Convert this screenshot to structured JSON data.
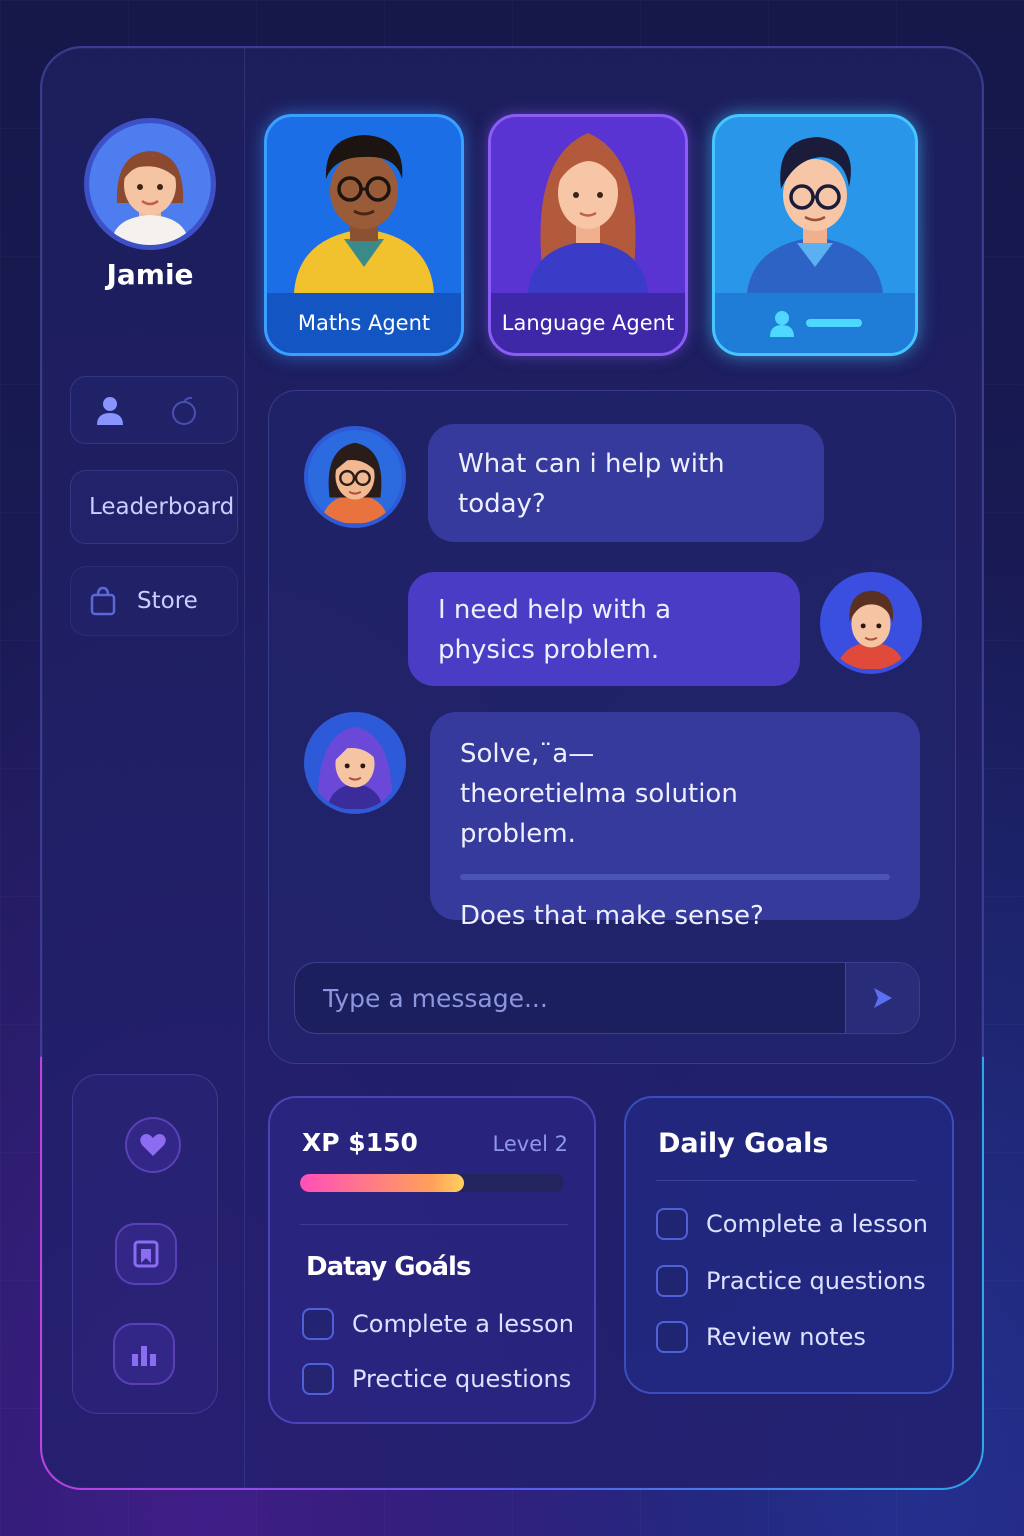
{
  "user": {
    "name": "Jamie"
  },
  "agents": [
    {
      "label": "Maths Agent"
    },
    {
      "label": "Language Agent"
    },
    {
      "label": ""
    }
  ],
  "sidebar": {
    "leaderboard_label": "Leaderboard",
    "store_label": "Store"
  },
  "chat": {
    "messages": [
      {
        "from": "agent",
        "text": "What can i help with today?"
      },
      {
        "from": "user",
        "text": "I need help with a physics problem."
      },
      {
        "from": "agent",
        "text": "Solve,¨a—theoretielma solution problem.",
        "followup": "Does that make sense?"
      }
    ],
    "input": {
      "placeholder": "Type a message...",
      "value": ""
    }
  },
  "progress": {
    "xp_label": "XP $150",
    "level_label": "Level 2",
    "xp_fill_fraction": 0.62,
    "goals_title": "Datay Goáls",
    "goals": [
      {
        "label": "Complete a lesson",
        "checked": false
      },
      {
        "label": "Precticе questions",
        "checked": false
      }
    ]
  },
  "daily_goals": {
    "title": "Daily Goals",
    "items": [
      {
        "label": "Complete a lesson",
        "checked": false
      },
      {
        "label": "Practice questions",
        "checked": false
      },
      {
        "label": "Review notes",
        "checked": false
      }
    ]
  },
  "colors": {
    "accent_blue": "#1b6ee6",
    "accent_purple": "#5a34d2",
    "accent_cyan": "#2a96ea",
    "xp_gradient_start": "#ff4fb8",
    "xp_gradient_end": "#ffd060"
  },
  "icons": {
    "send": "send-arrow-icon",
    "store": "shopping-bag-icon",
    "user": "user-icon",
    "heart": "heart-icon",
    "bookmark": "bookmark-icon",
    "chart": "bar-chart-icon"
  }
}
